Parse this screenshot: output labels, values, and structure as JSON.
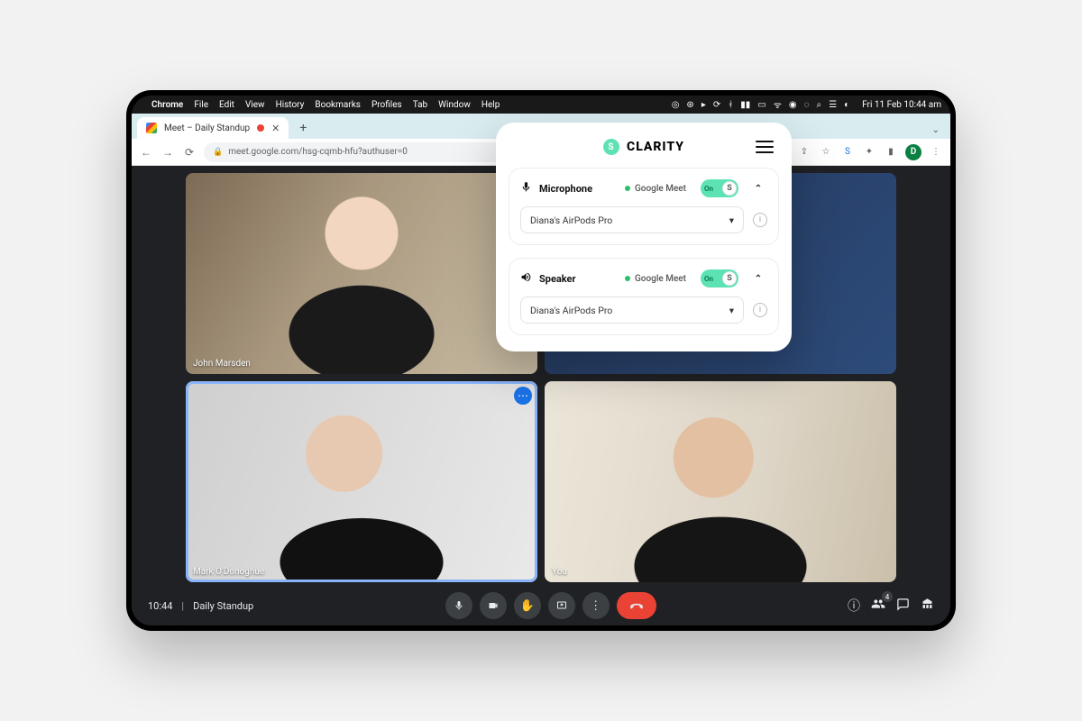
{
  "menubar": {
    "app": "Chrome",
    "items": [
      "File",
      "Edit",
      "View",
      "History",
      "Bookmarks",
      "Profiles",
      "Tab",
      "Window",
      "Help"
    ],
    "clock": "Fri 11 Feb  10:44 am"
  },
  "browser": {
    "tab_title": "Meet – Daily Standup",
    "url": "meet.google.com/hsg-cqmb-hfu?authuser=0",
    "avatar_initial": "D"
  },
  "meet": {
    "time": "10:44",
    "title": "Daily Standup",
    "participant_count": "4",
    "tiles": [
      {
        "name": "John Marsden"
      },
      {
        "name": "Mark O'Donoghue"
      },
      {
        "name": "You"
      },
      {
        "name": ""
      }
    ]
  },
  "clarity": {
    "brand": "CLARITY",
    "sections": [
      {
        "label": "Microphone",
        "app": "Google Meet",
        "toggle": "On",
        "device": "Diana's AirPods Pro"
      },
      {
        "label": "Speaker",
        "app": "Google Meet",
        "toggle": "On",
        "device": "Diana's AirPods Pro"
      }
    ]
  }
}
